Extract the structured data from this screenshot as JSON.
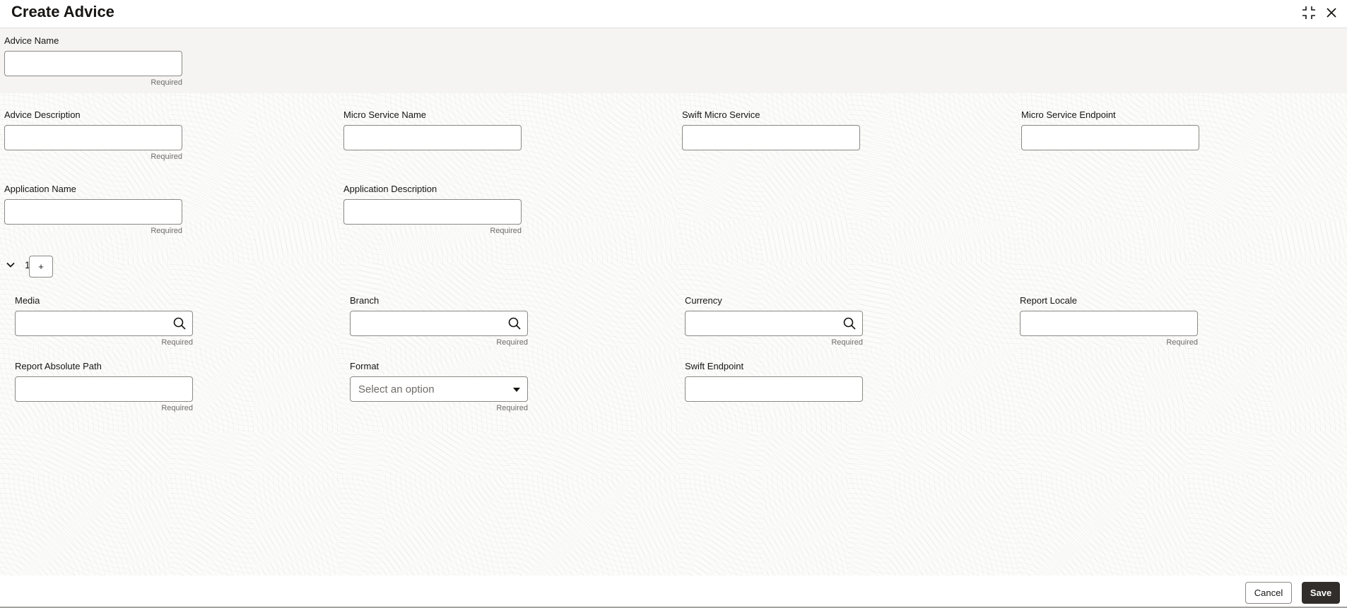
{
  "header": {
    "title": "Create Advice",
    "icons": [
      "collapse-icon",
      "close-icon"
    ]
  },
  "form": {
    "advice_name": {
      "label": "Advice Name",
      "value": "",
      "hint": "Required"
    },
    "advice_description": {
      "label": "Advice Description",
      "value": "",
      "hint": "Required"
    },
    "micro_service_name": {
      "label": "Micro Service Name",
      "value": ""
    },
    "swift_micro_service": {
      "label": "Swift Micro Service",
      "value": ""
    },
    "micro_service_endpoint": {
      "label": "Micro Service Endpoint",
      "value": ""
    },
    "application_name": {
      "label": "Application Name",
      "value": "",
      "hint": "Required"
    },
    "application_description": {
      "label": "Application Description",
      "value": "",
      "hint": "Required"
    }
  },
  "details": {
    "row_count": "1",
    "add_label": "+",
    "media": {
      "label": "Media",
      "value": "",
      "hint": "Required",
      "icon": "search-icon"
    },
    "branch": {
      "label": "Branch",
      "value": "",
      "hint": "Required",
      "icon": "search-icon"
    },
    "currency": {
      "label": "Currency",
      "value": "",
      "hint": "Required",
      "icon": "search-icon"
    },
    "report_locale": {
      "label": "Report Locale",
      "value": "",
      "hint": "Required"
    },
    "report_absolute_path": {
      "label": "Report Absolute Path",
      "value": "",
      "hint": "Required"
    },
    "format": {
      "label": "Format",
      "placeholder": "Select an option",
      "hint": "Required"
    },
    "swift_endpoint": {
      "label": "Swift Endpoint",
      "value": ""
    }
  },
  "footer": {
    "cancel_label": "Cancel",
    "save_label": "Save"
  }
}
